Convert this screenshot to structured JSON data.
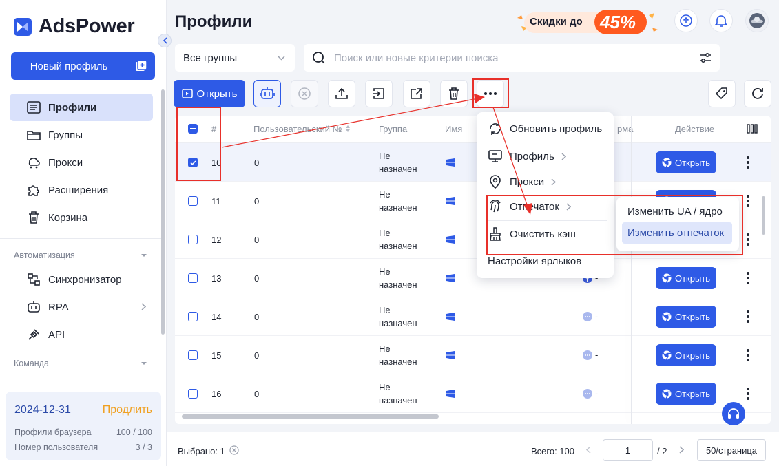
{
  "app": {
    "brand": "AdsPower"
  },
  "sidebar": {
    "new_profile": "Новый профиль",
    "items": [
      {
        "label": "Профили"
      },
      {
        "label": "Группы"
      },
      {
        "label": "Прокси"
      },
      {
        "label": "Расширения"
      },
      {
        "label": "Корзина"
      }
    ],
    "section_automation": "Автоматизация",
    "automation_items": [
      {
        "label": "Синхронизатор"
      },
      {
        "label": "RPA"
      },
      {
        "label": "API"
      }
    ],
    "section_team": "Команда",
    "account": {
      "date": "2024-12-31",
      "renew": "Продлить",
      "browser_profiles_label": "Профили браузера",
      "browser_profiles_value": "100 / 100",
      "user_number_label": "Номер пользователя",
      "user_number_value": "3 / 3"
    }
  },
  "header": {
    "title": "Профили",
    "promo_text": "Скидки до",
    "promo_value": "45%"
  },
  "filters": {
    "group_select": "Все группы",
    "search_placeholder": "Поиск или новые критерии поиска"
  },
  "toolbar": {
    "open_label": "Открыть"
  },
  "table": {
    "columns": {
      "index": "#",
      "user_no": "Пользовательский №",
      "group": "Группа",
      "name": "Имя",
      "platform": "рма",
      "action": "Действие"
    },
    "rows": [
      {
        "index": "10",
        "user_no": "0",
        "group_l1": "Не",
        "group_l2": "назначен",
        "platform": "",
        "open": "Открыть"
      },
      {
        "index": "11",
        "user_no": "0",
        "group_l1": "Не",
        "group_l2": "назначен",
        "platform": "",
        "open": "Открыть"
      },
      {
        "index": "12",
        "user_no": "0",
        "group_l1": "Не",
        "group_l2": "назначен",
        "platform": "",
        "open": "Открыть"
      },
      {
        "index": "13",
        "user_no": "0",
        "group_l1": "Не",
        "group_l2": "назначен",
        "platform": "-",
        "open": "Открыть"
      },
      {
        "index": "14",
        "user_no": "0",
        "group_l1": "Не",
        "group_l2": "назначен",
        "platform": "-",
        "open": "Открыть"
      },
      {
        "index": "15",
        "user_no": "0",
        "group_l1": "Не",
        "group_l2": "назначен",
        "platform": "-",
        "open": "Открыть"
      },
      {
        "index": "16",
        "user_no": "0",
        "group_l1": "Не",
        "group_l2": "назначен",
        "platform": "-",
        "open": "Открыть"
      }
    ]
  },
  "more_menu": {
    "refresh": "Обновить профиль",
    "profile": "Профиль",
    "proxy": "Прокси",
    "fingerprint": "Отпечаток",
    "clear_cache": "Очистить кэш",
    "label_settings": "Настройки ярлыков"
  },
  "fingerprint_submenu": {
    "change_ua": "Изменить UA / ядро",
    "change_fingerprint": "Изменить отпечаток"
  },
  "footer": {
    "selected": "Выбрано: 1",
    "total": "Всего: 100",
    "page": "1",
    "pages": "/ 2",
    "per_page": "50/страница"
  },
  "colors": {
    "accent": "#2e5ae6",
    "annotation": "#e8302a",
    "promo": "#ff5a1f"
  }
}
